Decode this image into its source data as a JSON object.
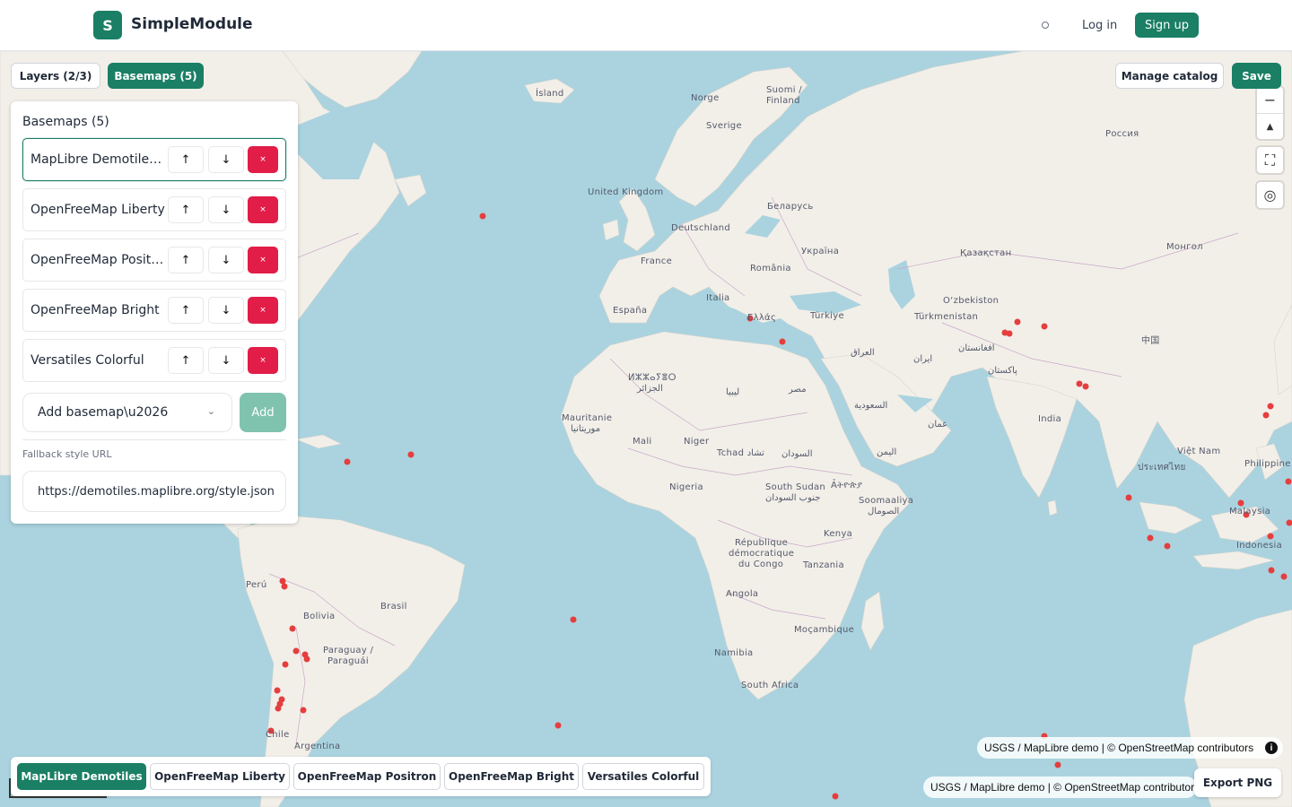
{
  "header": {
    "logo_letter": "S",
    "brand": "SimpleModule",
    "login_label": "Log in",
    "signup_label": "Sign up"
  },
  "tabs": {
    "layers_label": "Layers (2/3)",
    "basemaps_label": "Basemaps (5)"
  },
  "panel": {
    "title": "Basemaps (5)",
    "items": [
      {
        "name": "MapLibre Demotiles…",
        "up": "↑",
        "down": "↓",
        "delete": "×"
      },
      {
        "name": "OpenFreeMap Liberty",
        "up": "↑",
        "down": "↓",
        "delete": "×"
      },
      {
        "name": "OpenFreeMap Positron",
        "up": "↑",
        "down": "↓",
        "delete": "×"
      },
      {
        "name": "OpenFreeMap Bright",
        "up": "↑",
        "down": "↓",
        "delete": "×"
      },
      {
        "name": "Versatiles Colorful",
        "up": "↑",
        "down": "↓",
        "delete": "×"
      }
    ],
    "add_select_label": "Add basemap\\u2026",
    "add_button": "Add",
    "fallback_label": "Fallback style URL",
    "fallback_value": "https://demotiles.maplibre.org/style.json"
  },
  "toolbar": {
    "manage_label": "Manage catalog",
    "save_label": "Save",
    "export_label": "Export PNG"
  },
  "controls": {
    "zoom_out": "−",
    "compass": "▲",
    "fullscreen": "⛶",
    "locate": "◎"
  },
  "attribution": {
    "text1": "USGS / MapLibre demo | © OpenStreetMap contributors",
    "info": "i",
    "text2": "USGS / MapLibre demo | © OpenStreetMap contributors"
  },
  "bottom_bar": [
    {
      "label": "MapLibre Demotiles",
      "active": true
    },
    {
      "label": "OpenFreeMap Liberty",
      "active": false
    },
    {
      "label": "OpenFreeMap Positron",
      "active": false
    },
    {
      "label": "OpenFreeMap Bright",
      "active": false
    },
    {
      "label": "Versatiles Colorful",
      "active": false
    }
  ],
  "map_labels": [
    "Ísland",
    "Norge",
    "Suomi /",
    "Finland",
    "Sverige",
    "Россия",
    "United Kingdom",
    "Беларусь",
    "Deutschland",
    "Україна",
    "Қазақстан",
    "Монгол",
    "France",
    "România",
    "O‘zbekiston",
    "Italia",
    "España",
    "Ελλάς",
    "Türkiye",
    "Türkmenistan",
    "افغانستان",
    "中国",
    "العراق",
    "ايران",
    "پاکستان",
    "ⵍⵣⵣⴰⵢⴻⵔ",
    "الجزائر",
    "ليبيا",
    "مصر",
    "السعودية",
    "Mauritanie",
    "موريتانيا",
    "عمان",
    "India",
    "Mali",
    "Niger",
    "Tchad تشاد",
    "السودان",
    "اليمن",
    "Việt Nam",
    "ประเทศไทย",
    "Philippine",
    "Nigeria",
    "South Sudan",
    "Ảትዮጵያ",
    "جنوب السودان",
    "Soomaaliya",
    "الصومال",
    "Malaysia",
    "Kenya",
    "République",
    "démocratique",
    "du Congo",
    "Tanzania",
    "Indonesia",
    "Perú",
    "Brasil",
    "Angola",
    "Bolivia",
    "Paraguay /",
    "Paraguái",
    "Moçambique",
    "Namibia",
    "South Africa",
    "Chile",
    "Argentina"
  ]
}
